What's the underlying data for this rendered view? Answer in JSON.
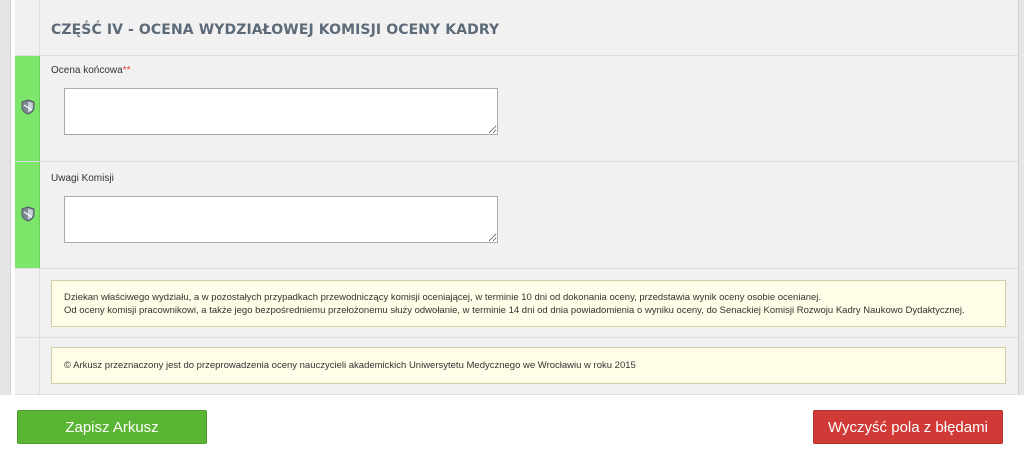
{
  "section": {
    "title": "CZĘŚĆ IV - OCENA WYDZIAŁOWEJ KOMISJI OCENY KADRY"
  },
  "fields": [
    {
      "label": "Ocena końcowa",
      "required_mark": "**",
      "value": "",
      "status": "valid"
    },
    {
      "label": "Uwagi Komisji",
      "required_mark": "",
      "value": "",
      "status": "valid"
    }
  ],
  "notes": {
    "deadline_line1": "Dziekan właściwego wydziału, a w pozostałych przypadkach przewodniczący komisji oceniającej, w terminie 10 dni od dokonania oceny, przedstawia wynik oceny osobie ocenianej.",
    "deadline_line2": "Od oceny komisji pracownikowi, a także jego bezpośredniemu przełożonemu służy odwołanie, w terminie 14 dni od dnia powiadomienia o wyniku oceny, do Senackiej Komisji Rozwoju Kadry Naukowo Dydaktycznej.",
    "copyright": "©  Arkusz przeznaczony jest do przeprowadzenia oceny nauczycieli akademickich Uniwersytetu Medycznego we Wrocławiu w roku 2015"
  },
  "buttons": {
    "save_label": "Zapisz Arkusz",
    "clear_label": "Wyczyść pola z błędami"
  },
  "colors": {
    "valid_gutter": "#7ee56b",
    "save_button": "#59b533",
    "clear_button": "#cf3a36",
    "note_background": "#fffde7"
  }
}
